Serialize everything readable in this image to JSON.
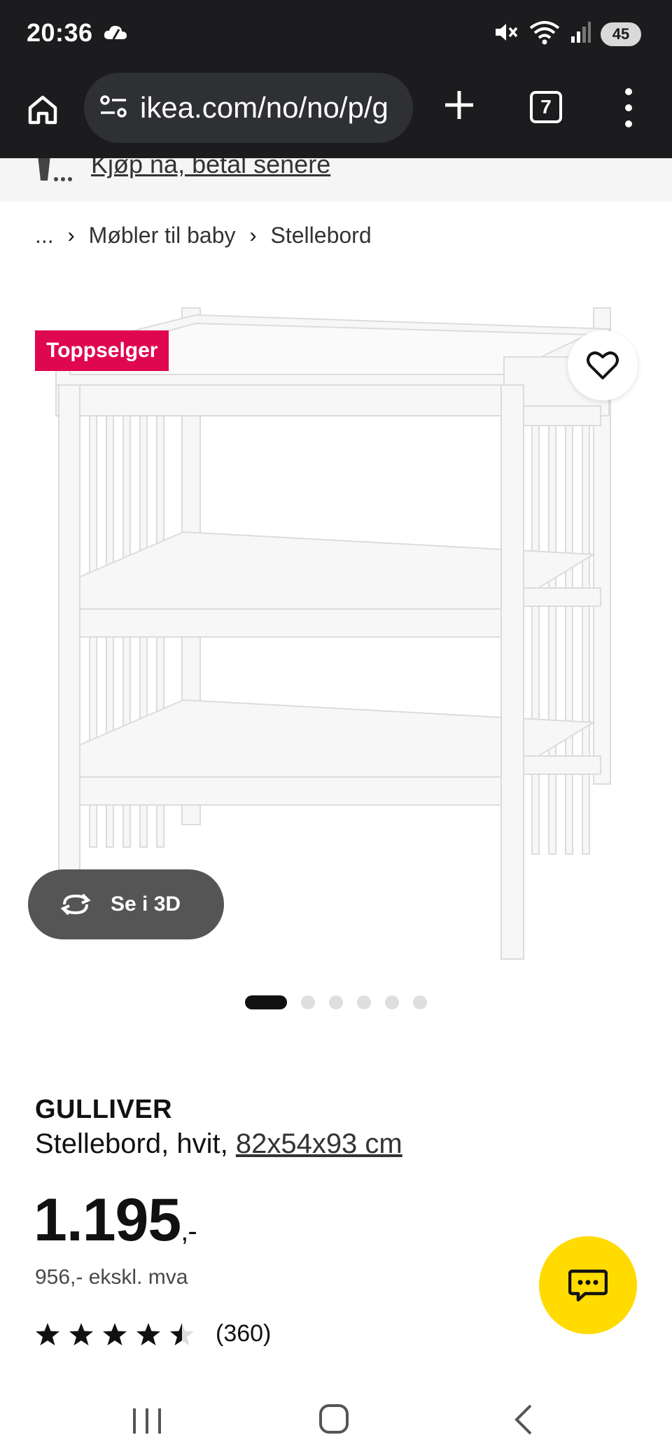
{
  "status_bar": {
    "time": "20:36",
    "battery": "45",
    "icons": [
      "cloud-icon",
      "mute-icon",
      "wifi-icon",
      "signal-icon",
      "battery-icon"
    ]
  },
  "browser": {
    "url": "ikea.com/no/no/p/g",
    "tab_count": "7",
    "icons": [
      "home-icon",
      "site-settings-icon",
      "plus-icon",
      "tabs-icon",
      "more-menu-icon"
    ]
  },
  "promo": {
    "text": "Kjøp nå, betal senere"
  },
  "breadcrumb": {
    "ellipsis": "...",
    "items": [
      "Møbler til baby",
      "Stellebord"
    ]
  },
  "product": {
    "badge": "Toppselger",
    "view_3d": "Se i 3D",
    "gallery_count": 6,
    "gallery_active": 1,
    "name": "GULLIVER",
    "description": "Stellebord, hvit, ",
    "measure": "82x54x93 cm",
    "price_main": "1.195",
    "price_suffix": ",-",
    "price_ex_vat": "956,- ekskl. mva",
    "rating_value": 4.5,
    "rating_count": "(360)"
  },
  "colors": {
    "badge": "#e00751",
    "chat": "#ffdb00",
    "dark_bar": "#1c1c1e"
  }
}
